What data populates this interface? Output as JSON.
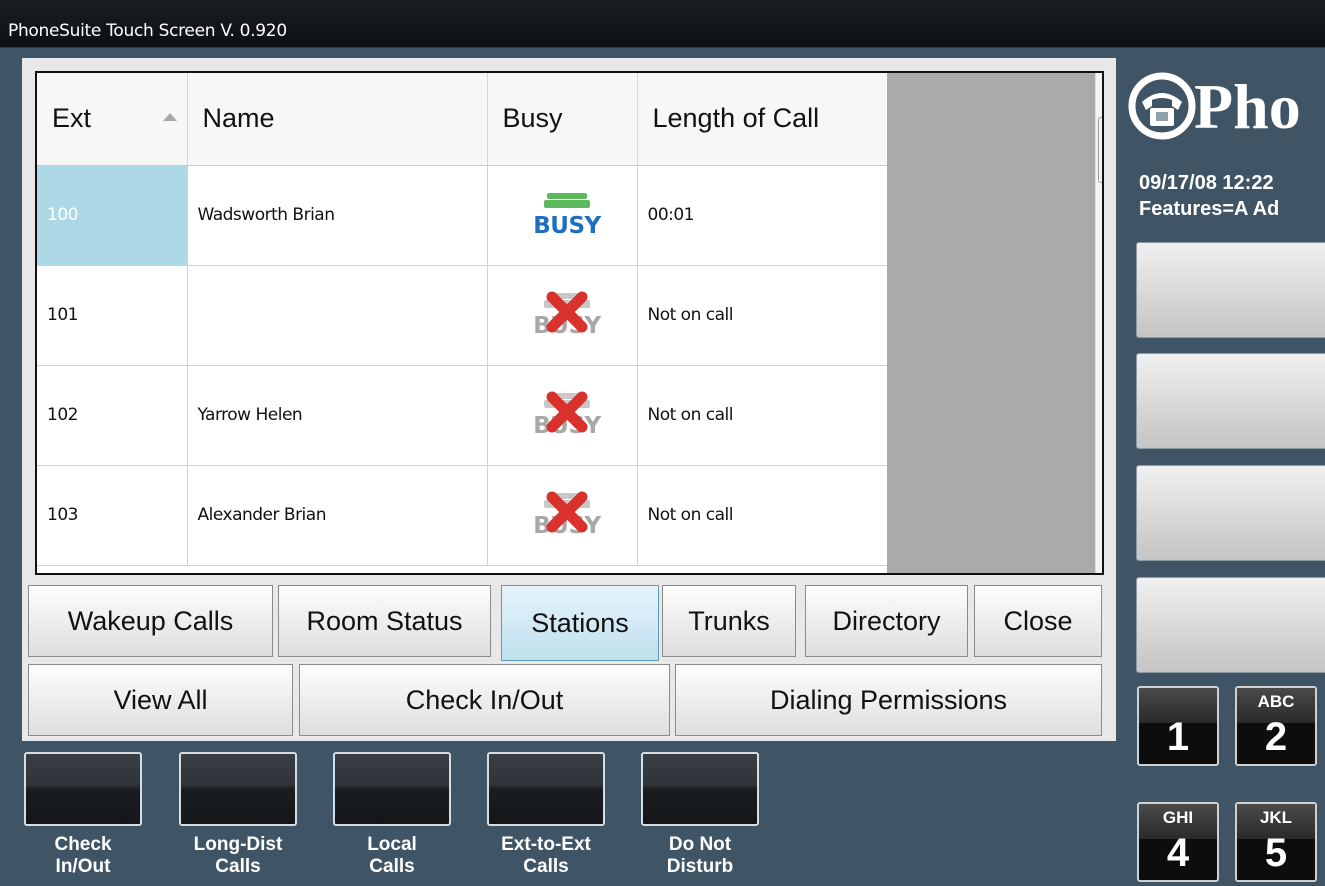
{
  "window": {
    "title": "PhoneSuite Touch Screen V. 0.920"
  },
  "grid": {
    "columns": [
      "Ext",
      "Name",
      "Busy",
      "Length of Call"
    ],
    "sort_column": "Ext",
    "rows": [
      {
        "ext": "100",
        "name": "Wadsworth  Brian",
        "busy": true,
        "length": "00:01"
      },
      {
        "ext": "101",
        "name": "",
        "busy": false,
        "length": "Not on call"
      },
      {
        "ext": "102",
        "name": "Yarrow  Helen",
        "busy": false,
        "length": "Not on call"
      },
      {
        "ext": "103",
        "name": "Alexander  Brian",
        "busy": false,
        "length": "Not on call"
      }
    ],
    "busy_label": "BUSY"
  },
  "tabs": {
    "wakeup": "Wakeup Calls",
    "room_status": "Room Status",
    "stations": "Stations",
    "trunks": "Trunks",
    "directory": "Directory",
    "close": "Close",
    "active": "Stations"
  },
  "actions": {
    "view_all": "View All",
    "check_in_out": "Check In/Out",
    "dialing_permissions": "Dialing Permissions"
  },
  "feature_keys": [
    {
      "line1": "Check",
      "line2": "In/Out"
    },
    {
      "line1": "Long-Dist",
      "line2": "Calls"
    },
    {
      "line1": "Local",
      "line2": "Calls"
    },
    {
      "line1": "Ext-to-Ext",
      "line2": "Calls"
    },
    {
      "line1": "Do Not",
      "line2": "Disturb"
    }
  ],
  "side": {
    "logo_text": "Pho",
    "datetime": "09/17/08   12:22",
    "features": "Features=A Ad"
  },
  "keypad": [
    {
      "num": "1",
      "letters": ""
    },
    {
      "num": "2",
      "letters": "ABC"
    },
    {
      "num": "4",
      "letters": "GHI"
    },
    {
      "num": "5",
      "letters": "JKL"
    }
  ],
  "colors": {
    "background": "#3f5566",
    "selected_cell": "#add8e6",
    "busy_green": "#5cb85c",
    "busy_blue": "#1e6fc0",
    "not_busy_red": "#d9312b"
  }
}
